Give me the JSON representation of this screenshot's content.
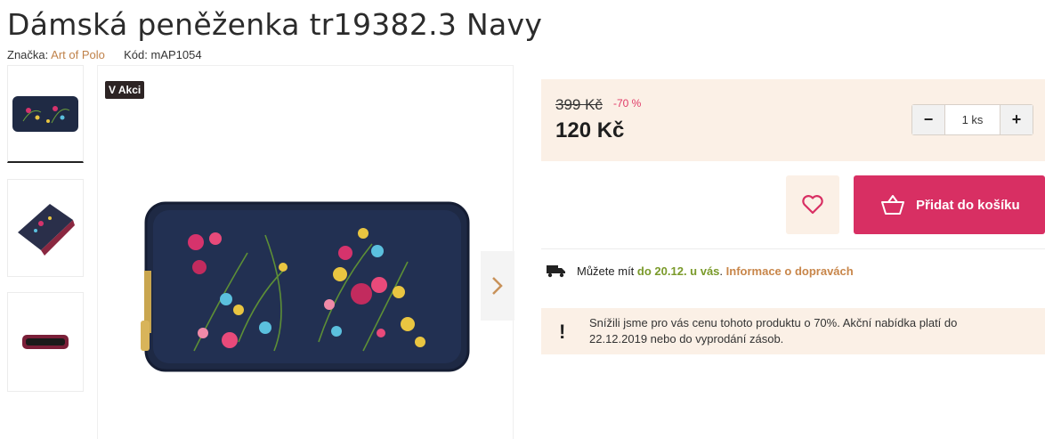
{
  "product": {
    "title": "Dámská peněženka tr19382.3 Navy",
    "brand_label": "Značka:",
    "brand": "Art of Polo",
    "code_label": "Kód:",
    "code": "mAP1054"
  },
  "gallery": {
    "badge": "V Akci",
    "next_icon": "chevron-right-icon",
    "thumbnails": [
      "wallet-front",
      "wallet-open-side",
      "wallet-open-top"
    ]
  },
  "pricing": {
    "old_price": "399 Kč",
    "discount": "-70 %",
    "new_price": "120 Kč"
  },
  "quantity": {
    "minus": "−",
    "value": "1 ks",
    "plus": "+"
  },
  "actions": {
    "favorite_icon": "heart-icon",
    "add_to_cart": "Přidat do košíku",
    "cart_icon": "basket-icon"
  },
  "delivery": {
    "prefix": "Můžete mít ",
    "date": "do 20.12. u vás",
    "separator": ". ",
    "link": "Informace o dopravách"
  },
  "notice": {
    "icon": "!",
    "text": "Snížili jsme pro vás cenu tohoto produktu o 70%. Akční nabídka platí do 22.12.2019 nebo do vyprodání zásob."
  },
  "colors": {
    "accent": "#d82f63",
    "brand_link": "#c0824a",
    "panel_bg": "#fbf0e6",
    "discount": "#e03a67",
    "delivery_date": "#7a9a2a"
  }
}
